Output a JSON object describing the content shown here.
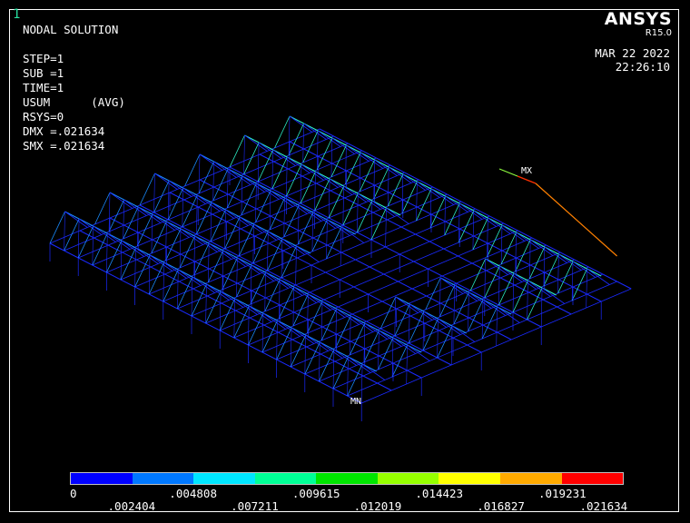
{
  "window_number": "1",
  "logo": {
    "name": "ANSYS",
    "version": "R15.0"
  },
  "info_lines": [
    "NODAL SOLUTION",
    "",
    "STEP=1",
    "SUB =1",
    "TIME=1",
    "USUM      (AVG)",
    "RSYS=0",
    "DMX =.021634",
    "SMX =.021634"
  ],
  "date": "MAR 22 2022",
  "time": "22:26:10",
  "max_label": "MX",
  "min_label": "MN",
  "legend": {
    "colors": [
      "#0000ff",
      "#0078ff",
      "#00e6ff",
      "#00ff96",
      "#00e600",
      "#96ff00",
      "#ffff00",
      "#ffaa00",
      "#ff0000"
    ],
    "top_ticks": [
      "0",
      ".004808",
      ".009615",
      ".014423",
      ".019231"
    ],
    "bottom_ticks": [
      ".002404",
      ".007211",
      ".012019",
      ".016827",
      ".021634"
    ]
  }
}
